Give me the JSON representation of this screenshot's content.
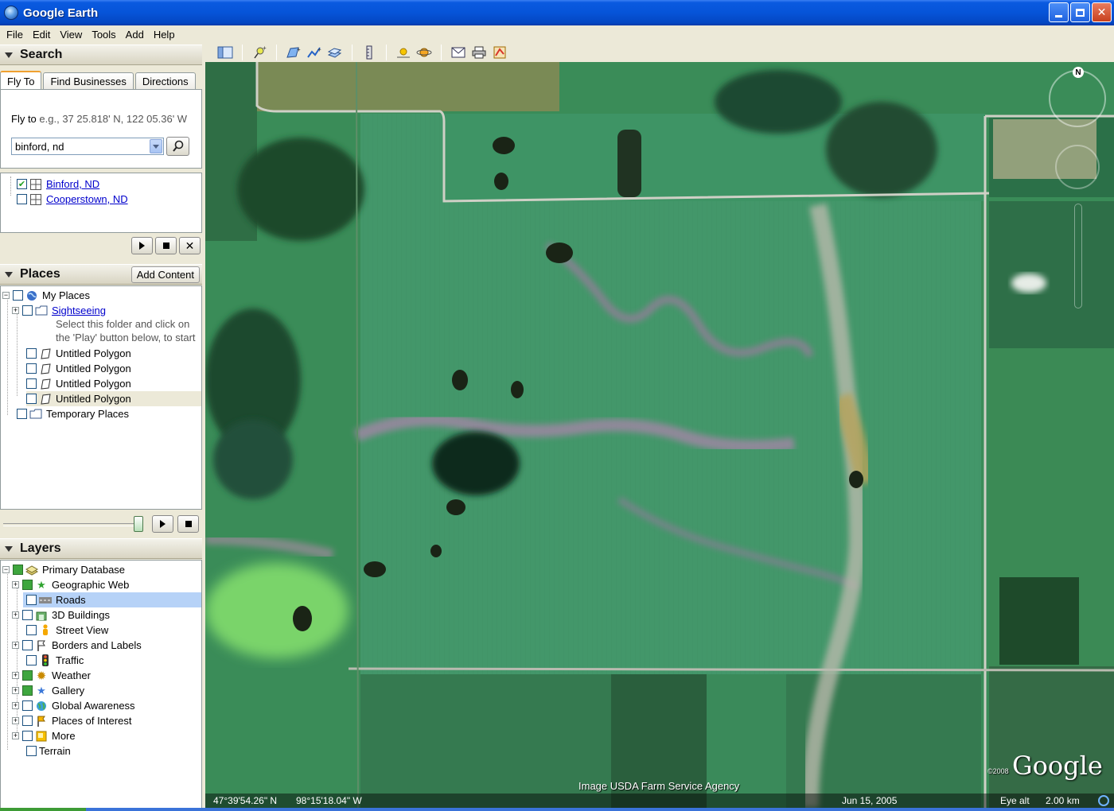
{
  "window": {
    "title": "Google Earth"
  },
  "menu": [
    "File",
    "Edit",
    "View",
    "Tools",
    "Add",
    "Help"
  ],
  "search": {
    "header": "Search",
    "tabs": [
      "Fly To",
      "Find Businesses",
      "Directions"
    ],
    "flyto_label": "Fly to",
    "flyto_example": "e.g., 37 25.818' N, 122 05.36' W",
    "query": "binford, nd",
    "results": [
      {
        "label": "Binford, ND",
        "checked": true
      },
      {
        "label": "Cooperstown, ND",
        "checked": false
      }
    ]
  },
  "places": {
    "header": "Places",
    "add_content": "Add Content",
    "my_places": "My Places",
    "sightseeing": "Sightseeing",
    "hint_line1": "Select this folder and click on",
    "hint_line2": "the 'Play' button below, to start",
    "polygons": [
      "Untitled Polygon",
      "Untitled Polygon",
      "Untitled Polygon",
      "Untitled Polygon"
    ],
    "temporary": "Temporary Places"
  },
  "layers": {
    "header": "Layers",
    "root": "Primary Database",
    "items": [
      {
        "label": "Geographic Web",
        "icon": "star-icon"
      },
      {
        "label": "Roads",
        "icon": "road-icon"
      },
      {
        "label": "3D Buildings",
        "icon": "building-icon"
      },
      {
        "label": "Street View",
        "icon": "pegman-icon"
      },
      {
        "label": "Borders and Labels",
        "icon": "flag-icon"
      },
      {
        "label": "Traffic",
        "icon": "traffic-light-icon"
      },
      {
        "label": "Weather",
        "icon": "sun-icon"
      },
      {
        "label": "Gallery",
        "icon": "star-icon"
      },
      {
        "label": "Global Awareness",
        "icon": "globe-icon"
      },
      {
        "label": "Places of Interest",
        "icon": "flag-icon"
      },
      {
        "label": "More",
        "icon": "more-icon"
      }
    ],
    "terrain": "Terrain"
  },
  "map": {
    "attribution": "Image USDA Farm Service Agency",
    "logo": "Google",
    "logo_year": "©2008",
    "compass_n": "N",
    "status": {
      "lat": "47°39'54.26\" N",
      "lon": "98°15'18.04\" W",
      "date": "Jun 15, 2005",
      "eye_alt_label": "Eye alt",
      "eye_alt": "2.00 km"
    }
  }
}
